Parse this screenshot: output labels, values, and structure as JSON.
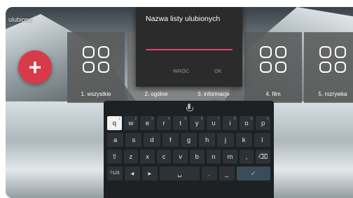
{
  "screen": {
    "fav_title": "ulubione"
  },
  "add_button": {
    "symbol": "+"
  },
  "tiles": [
    {
      "label": "1. wszystkie"
    },
    {
      "label": "2. ogólne"
    },
    {
      "label": "3. informacje"
    },
    {
      "label": "4. film"
    },
    {
      "label": "5. rozrywka"
    }
  ],
  "dialog": {
    "title": "Nazwa listy ulubionych",
    "input_value": "",
    "back_label": "WRÓĆ",
    "ok_label": "OK"
  },
  "keyboard": {
    "row1": [
      {
        "k": "q",
        "s": "1"
      },
      {
        "k": "w",
        "s": "2"
      },
      {
        "k": "e",
        "s": "3"
      },
      {
        "k": "r",
        "s": "4"
      },
      {
        "k": "t",
        "s": "5"
      },
      {
        "k": "y",
        "s": "6"
      },
      {
        "k": "u",
        "s": "7"
      },
      {
        "k": "i",
        "s": "8"
      },
      {
        "k": "o",
        "s": "9"
      },
      {
        "k": "p",
        "s": "0"
      }
    ],
    "row2": [
      "a",
      "s",
      "d",
      "f",
      "g",
      "h",
      "j",
      "k",
      "l"
    ],
    "row3": [
      "⇧",
      "z",
      "x",
      "c",
      "v",
      "b",
      "n",
      "m",
      ",",
      "⌫"
    ],
    "row4": {
      "symbols": "?123",
      "left": "◀",
      "right": "▶",
      "space": "␣",
      "dot": ".",
      "dash": "_",
      "enter": "✓"
    }
  },
  "colors": {
    "accent_red": "#d83a4a",
    "underline_pink": "#e0446a",
    "keyboard_bg": "#1d2124"
  }
}
